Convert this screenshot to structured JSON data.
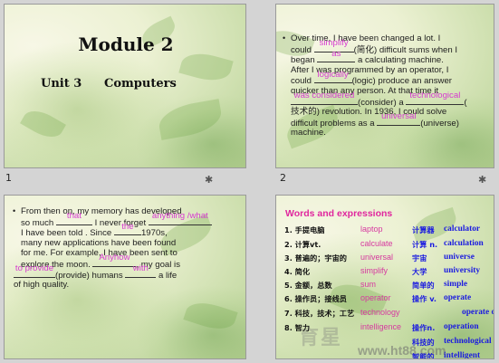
{
  "slide1": {
    "title": "Module 2",
    "unit": "Unit  3",
    "topic": "Computers",
    "number": "1"
  },
  "slide2": {
    "number": "2",
    "lines": {
      "l1": "Over time, I have been changed a lot.  I",
      "l2a": "could ",
      "l2b": "(简化) difficult sums when I",
      "l3a": "began ",
      "l3b": " a calculating machine.",
      "l4": "After I was programmed by an operator, I",
      "l5a": "could ",
      "l5b": "(logic) produce an answer",
      "l6": "quicker than any person.  At that time it",
      "l7a": "(consider) a ",
      "l7b": "(",
      "l8": "技术的) revolution.  In 1936, I could solve",
      "l9a": "difficult problems as a ",
      "l9b": "(universe)",
      "l10": "machine."
    },
    "answers": {
      "a1": "simplify",
      "a2": "as",
      "a3": "logically",
      "a4": "was considered",
      "a5": "technological",
      "a6": "universal"
    }
  },
  "slide3": {
    "number": "",
    "lines": {
      "l1": "From then on, my memory has developed",
      "l2a": "so much ",
      "l2b": " I never forget ",
      "l3a": "I have been told .  Since ",
      "l3b": "1970s,",
      "l4": "many new applications have been found",
      "l5": "for me.  For example, I have been sent to",
      "l6a": "explore the moon.  ",
      "l6b": ", my goal is",
      "l7b": "(provide) humans ",
      "l7c": " a life",
      "l8": "of high quality."
    },
    "answers": {
      "a1": "that",
      "a2": "anything /what",
      "a3": "the",
      "a4": "Anyhow",
      "a5": "to provide",
      "a6": "with"
    }
  },
  "slide4": {
    "title": "Words and expressions",
    "rows": [
      {
        "cn": "1. 手提电脑",
        "en": "laptop",
        "cn2": "计算器",
        "en2": "calculator"
      },
      {
        "cn": "2. 计算vt.",
        "en": "calculate",
        "cn2": "计算 n.",
        "en2": "calculation"
      },
      {
        "cn": "3. 普遍的；宇宙的",
        "en": "universal",
        "cn2": "宇宙",
        "en2": "universe"
      },
      {
        "cn": "4. 简化",
        "en": "simplify",
        "cn2": "大学",
        "en2": "university"
      },
      {
        "cn": "5. 金额，总数",
        "en": "sum",
        "cn2": "简单的",
        "en2": "simple"
      },
      {
        "cn": "6. 操作员；接线员",
        "en": "operator",
        "cn2": "操作 v.",
        "en2": "operate"
      },
      {
        "cn": "7. 科技，技术；工艺",
        "en": "technology",
        "cn2": "",
        "en2": "operate on"
      },
      {
        "cn": "8. 智力",
        "en": "intelligence",
        "cn2": "操作n.",
        "en2": "operation"
      },
      {
        "cn": "",
        "en": "",
        "cn2": "科技的",
        "en2": "technological"
      },
      {
        "cn": "",
        "en": "",
        "cn2": "智能的",
        "en2": "intelligent"
      }
    ]
  },
  "watermark": {
    "text1": "育星",
    "text2": "www.ht88.com"
  },
  "colors": {
    "answer": "#d63ad0",
    "heading_pink": "#e0269e",
    "term_blue": "#1b1be0"
  }
}
